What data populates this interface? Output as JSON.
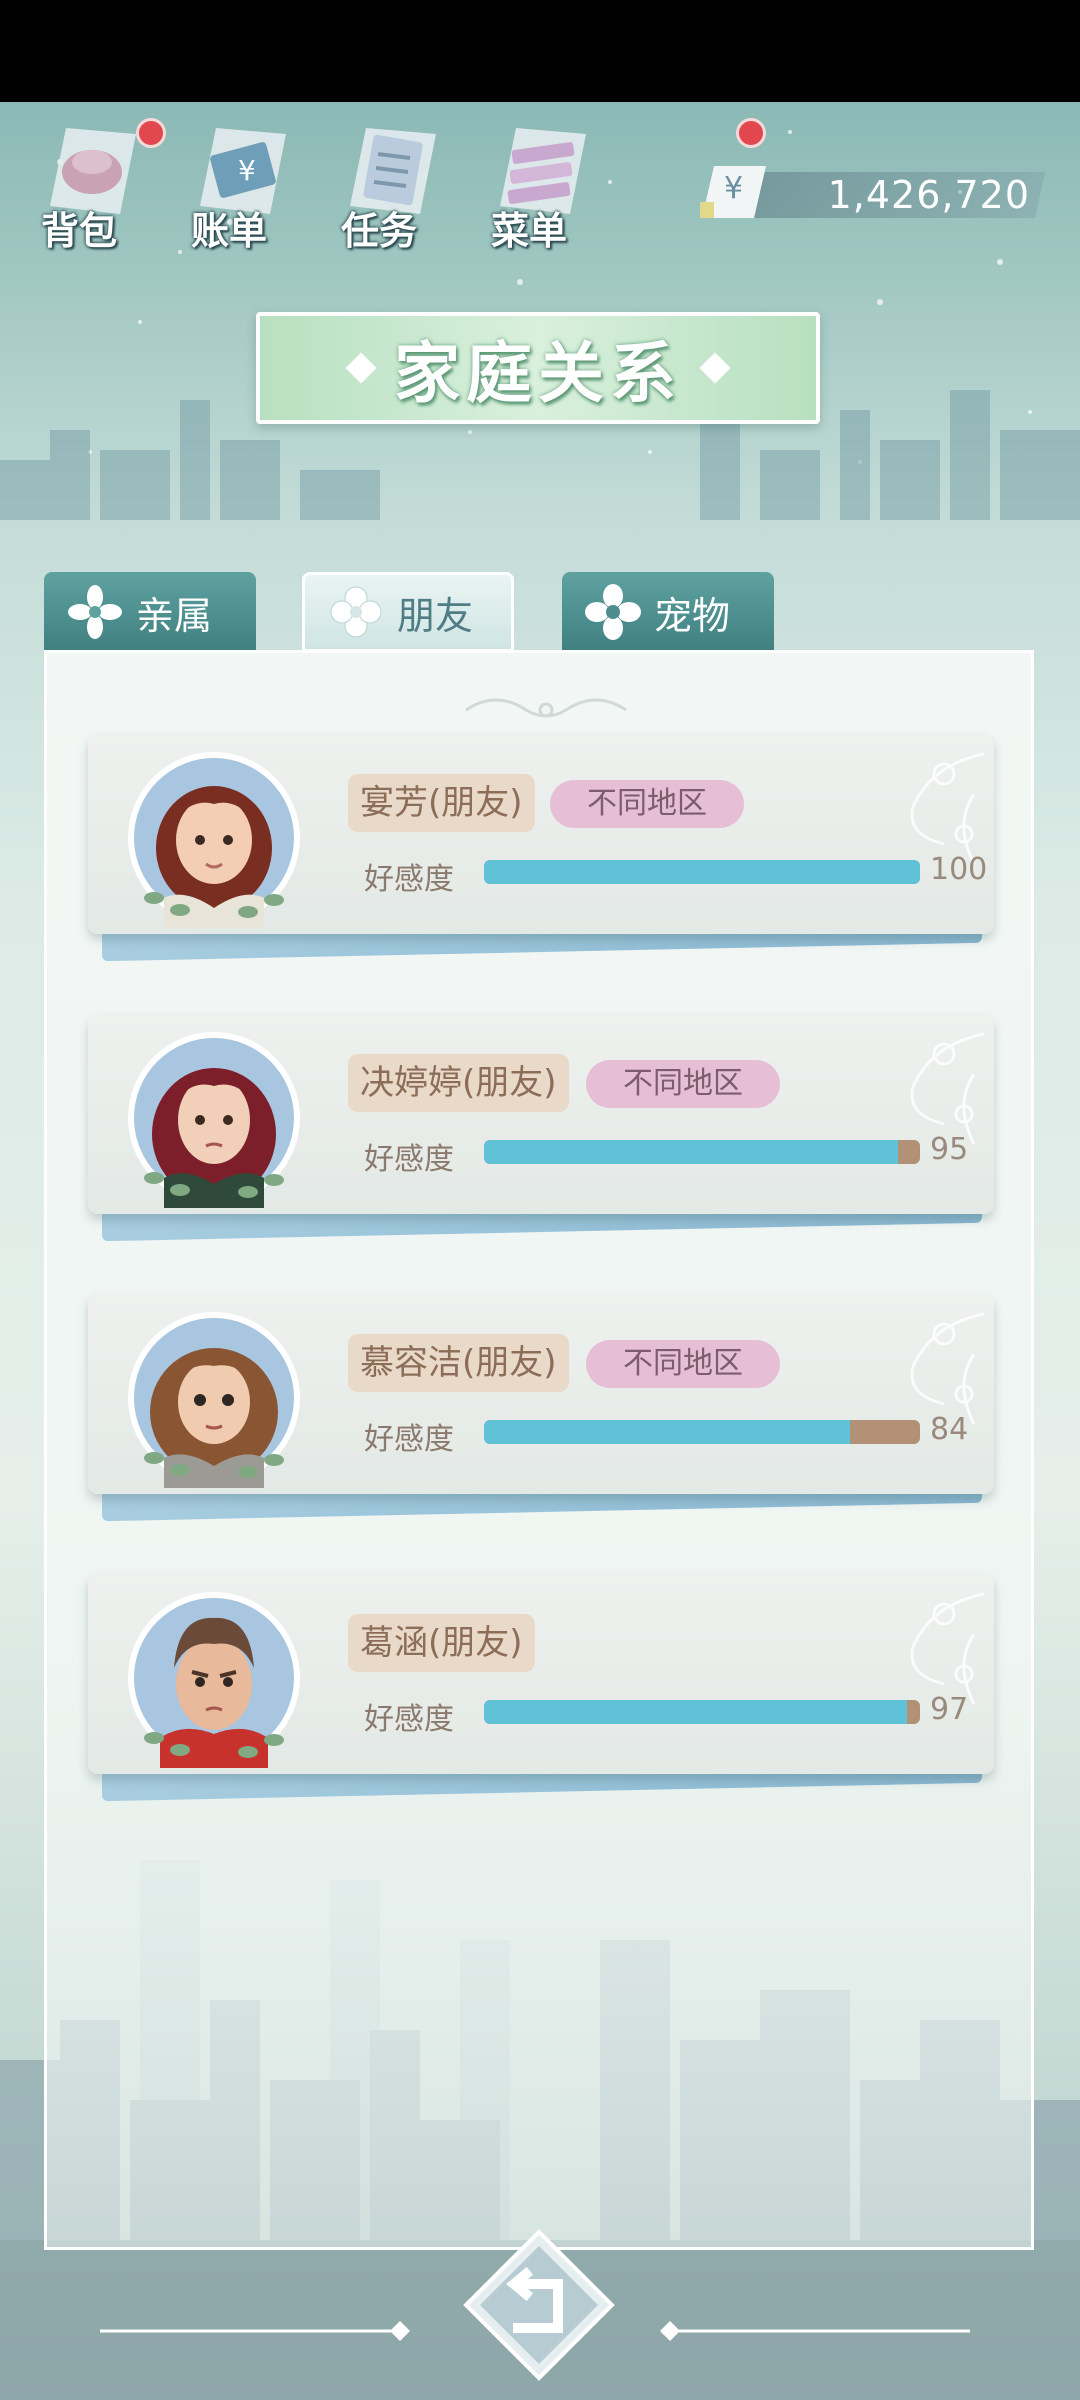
{
  "topnav": {
    "items": [
      {
        "label": "背包",
        "icon": "backpack-icon",
        "has_badge": true
      },
      {
        "label": "账单",
        "icon": "bill-icon",
        "has_badge": false
      },
      {
        "label": "任务",
        "icon": "task-icon",
        "has_badge": true
      },
      {
        "label": "菜单",
        "icon": "menu-icon",
        "has_badge": false
      }
    ]
  },
  "money": {
    "currency_symbol": "¥",
    "value": "1,426,720"
  },
  "title": "家庭关系",
  "tabs": [
    {
      "label": "亲属",
      "active": false
    },
    {
      "label": "朋友",
      "active": true
    },
    {
      "label": "宠物",
      "active": false
    }
  ],
  "affinity_label": "好感度",
  "friends": [
    {
      "name": "宴芳(朋友)",
      "region": "不同地区",
      "affinity": 100,
      "affinity_max": 100
    },
    {
      "name": "决婷婷(朋友)",
      "region": "不同地区",
      "affinity": 95,
      "affinity_max": 100
    },
    {
      "name": "慕容洁(朋友)",
      "region": "不同地区",
      "affinity": 84,
      "affinity_max": 100
    },
    {
      "name": "葛涵(朋友)",
      "region": "",
      "affinity": 97,
      "affinity_max": 100
    }
  ],
  "colors": {
    "affinity_fill": "#5fc2d6",
    "affinity_track": "#b29177",
    "badge": "#e2474f",
    "region_tag": "#e6bfd6",
    "name_tag": "#e9d9c9"
  }
}
